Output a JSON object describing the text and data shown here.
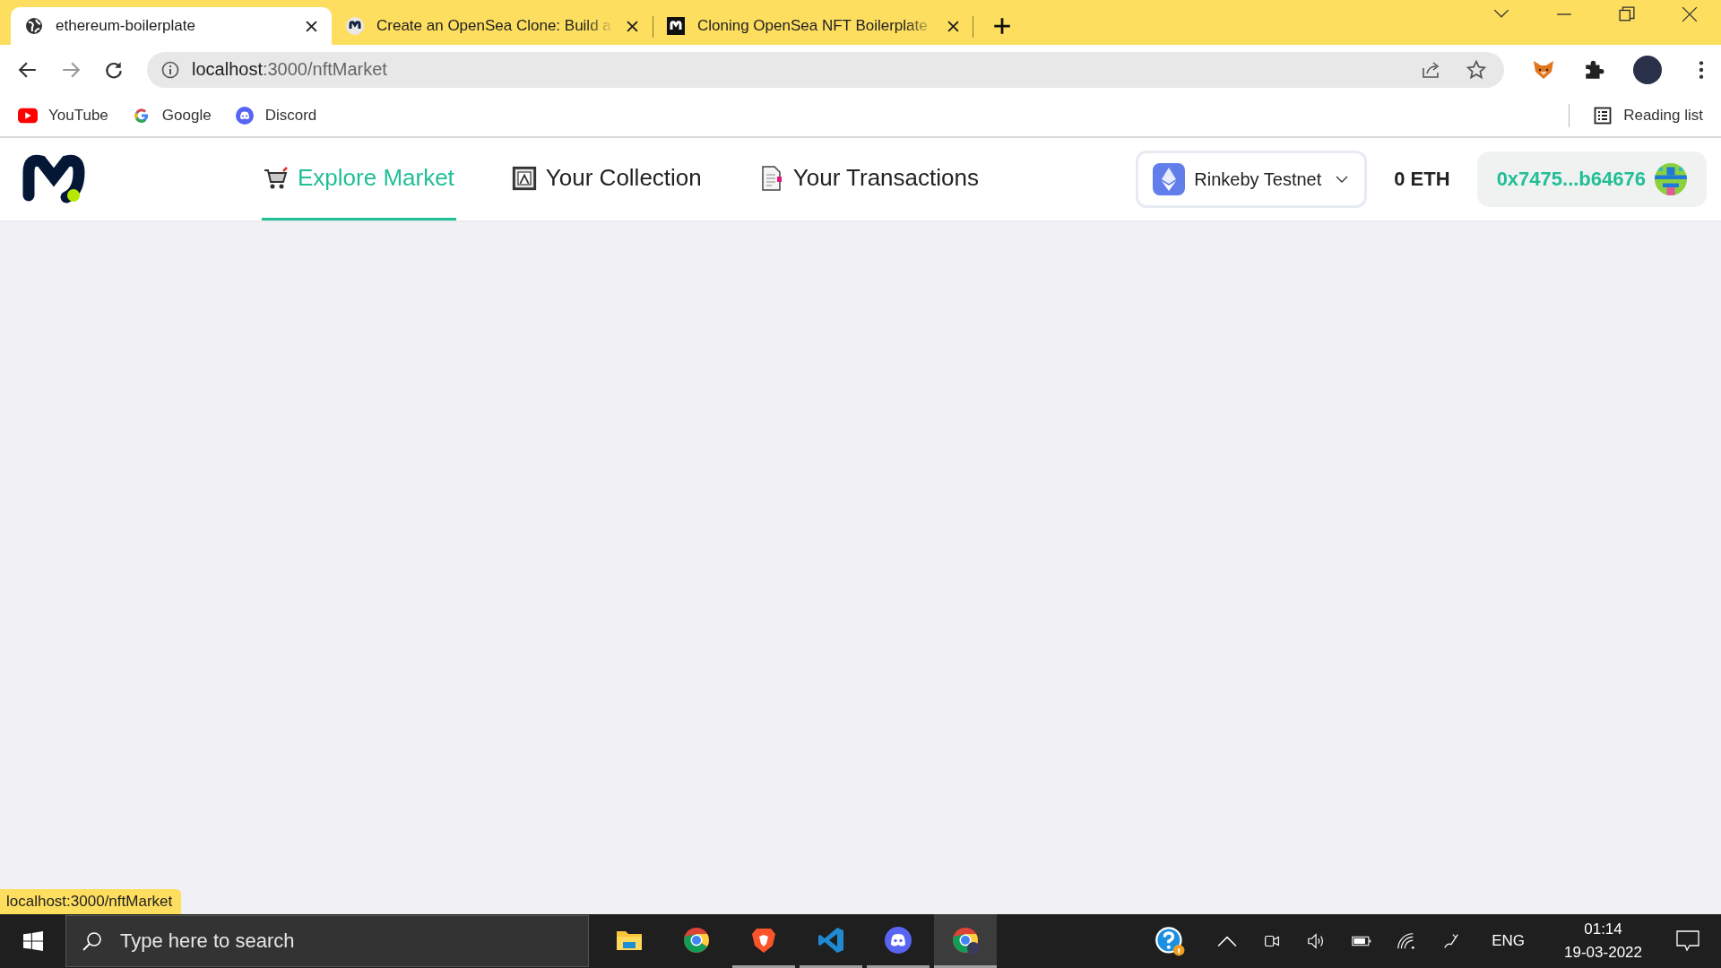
{
  "browser": {
    "tabs": [
      {
        "title": "ethereum-boilerplate",
        "kind": "globe",
        "selected": true
      },
      {
        "title": "Create an OpenSea Clone: Build a",
        "kind": "moralis",
        "selected": false
      },
      {
        "title": "Cloning OpenSea NFT Boilerplate",
        "kind": "moralis-dark",
        "selected": false
      }
    ],
    "address": {
      "host": "localhost",
      "path": ":3000/nftMarket"
    },
    "bookmarks": [
      {
        "label": "YouTube",
        "kind": "youtube"
      },
      {
        "label": "Google",
        "kind": "google"
      },
      {
        "label": "Discord",
        "kind": "discord"
      }
    ],
    "reading_list": "Reading list"
  },
  "app": {
    "nav": [
      {
        "label": "Explore Market",
        "kind": "cart",
        "selected": true
      },
      {
        "label": "Your Collection",
        "kind": "frame",
        "selected": false
      },
      {
        "label": "Your Transactions",
        "kind": "page",
        "selected": false
      }
    ],
    "network": "Rinkeby Testnet",
    "balance": "0 ETH",
    "account": "0x7475...b64676"
  },
  "status_link": "localhost:3000/nftMarket",
  "taskbar": {
    "search_placeholder": "Type here to search",
    "apps": [
      {
        "kind": "explorer",
        "running": false,
        "active": false
      },
      {
        "kind": "chrome",
        "running": false,
        "active": false
      },
      {
        "kind": "brave",
        "running": true,
        "active": false
      },
      {
        "kind": "vscode",
        "running": true,
        "active": false
      },
      {
        "kind": "discord",
        "running": true,
        "active": false
      },
      {
        "kind": "chrome-profile",
        "running": true,
        "active": true
      }
    ],
    "language": "ENG",
    "time": "01:14",
    "date": "19-03-2022"
  }
}
